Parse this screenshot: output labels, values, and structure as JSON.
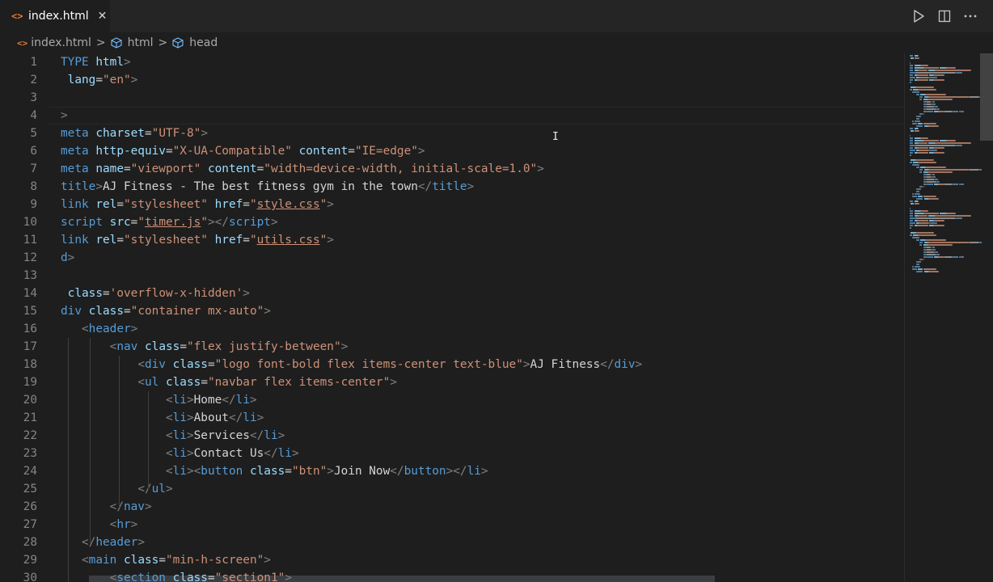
{
  "tab": {
    "icon": "html-file-icon",
    "icon_glyph": "<>",
    "label": "index.html",
    "close_glyph": "✕"
  },
  "actions": {
    "run": "run-icon",
    "split": "split-editor-icon",
    "more": "more-icon"
  },
  "breadcrumb": {
    "file": "index.html",
    "items": [
      "html",
      "head"
    ],
    "separator": ">"
  },
  "editor": {
    "lines": [
      {
        "n": "1",
        "tokens": [
          [
            "tag",
            "TYPE"
          ],
          [
            "text",
            " "
          ],
          [
            "attr",
            "html"
          ],
          [
            "brk",
            ">"
          ]
        ]
      },
      {
        "n": "2",
        "tokens": [
          [
            "text",
            " "
          ],
          [
            "attr",
            "lang"
          ],
          [
            "text",
            "="
          ],
          [
            "str",
            "\"en\""
          ],
          [
            "brk",
            ">"
          ]
        ]
      },
      {
        "n": "3",
        "tokens": []
      },
      {
        "n": "4",
        "tokens": [
          [
            "brk",
            ">"
          ]
        ]
      },
      {
        "n": "5",
        "tokens": [
          [
            "tag",
            "meta"
          ],
          [
            "text",
            " "
          ],
          [
            "attr",
            "charset"
          ],
          [
            "text",
            "="
          ],
          [
            "str",
            "\"UTF-8\""
          ],
          [
            "brk",
            ">"
          ]
        ]
      },
      {
        "n": "6",
        "tokens": [
          [
            "tag",
            "meta"
          ],
          [
            "text",
            " "
          ],
          [
            "attr",
            "http-equiv"
          ],
          [
            "text",
            "="
          ],
          [
            "str",
            "\"X-UA-Compatible\""
          ],
          [
            "text",
            " "
          ],
          [
            "attr",
            "content"
          ],
          [
            "text",
            "="
          ],
          [
            "str",
            "\"IE=edge\""
          ],
          [
            "brk",
            ">"
          ]
        ]
      },
      {
        "n": "7",
        "tokens": [
          [
            "tag",
            "meta"
          ],
          [
            "text",
            " "
          ],
          [
            "attr",
            "name"
          ],
          [
            "text",
            "="
          ],
          [
            "str",
            "\"viewport\""
          ],
          [
            "text",
            " "
          ],
          [
            "attr",
            "content"
          ],
          [
            "text",
            "="
          ],
          [
            "str",
            "\"width=device-width, initial-scale=1.0\""
          ],
          [
            "brk",
            ">"
          ]
        ]
      },
      {
        "n": "8",
        "tokens": [
          [
            "tag",
            "title"
          ],
          [
            "brk",
            ">"
          ],
          [
            "text",
            "AJ Fitness - The best fitness gym in the town"
          ],
          [
            "brk",
            "</"
          ],
          [
            "tag",
            "title"
          ],
          [
            "brk",
            ">"
          ]
        ]
      },
      {
        "n": "9",
        "tokens": [
          [
            "tag",
            "link"
          ],
          [
            "text",
            " "
          ],
          [
            "attr",
            "rel"
          ],
          [
            "text",
            "="
          ],
          [
            "str",
            "\"stylesheet\""
          ],
          [
            "text",
            " "
          ],
          [
            "attr",
            "href"
          ],
          [
            "text",
            "="
          ],
          [
            "str",
            "\""
          ],
          [
            "link",
            "style.css"
          ],
          [
            "str",
            "\""
          ],
          [
            "brk",
            ">"
          ]
        ]
      },
      {
        "n": "10",
        "tokens": [
          [
            "tag",
            "script"
          ],
          [
            "text",
            " "
          ],
          [
            "attr",
            "src"
          ],
          [
            "text",
            "="
          ],
          [
            "str",
            "\""
          ],
          [
            "link",
            "timer.js"
          ],
          [
            "str",
            "\""
          ],
          [
            "brk",
            "></"
          ],
          [
            "tag",
            "script"
          ],
          [
            "brk",
            ">"
          ]
        ]
      },
      {
        "n": "11",
        "tokens": [
          [
            "tag",
            "link"
          ],
          [
            "text",
            " "
          ],
          [
            "attr",
            "rel"
          ],
          [
            "text",
            "="
          ],
          [
            "str",
            "\"stylesheet\""
          ],
          [
            "text",
            " "
          ],
          [
            "attr",
            "href"
          ],
          [
            "text",
            "="
          ],
          [
            "str",
            "\""
          ],
          [
            "link",
            "utils.css"
          ],
          [
            "str",
            "\""
          ],
          [
            "brk",
            ">"
          ]
        ]
      },
      {
        "n": "12",
        "tokens": [
          [
            "tag",
            "d"
          ],
          [
            "brk",
            ">"
          ]
        ]
      },
      {
        "n": "13",
        "tokens": []
      },
      {
        "n": "14",
        "tokens": [
          [
            "text",
            " "
          ],
          [
            "attr",
            "class"
          ],
          [
            "text",
            "="
          ],
          [
            "str",
            "'overflow-x-hidden'"
          ],
          [
            "brk",
            ">"
          ]
        ]
      },
      {
        "n": "15",
        "tokens": [
          [
            "tag",
            "div"
          ],
          [
            "text",
            " "
          ],
          [
            "attr",
            "class"
          ],
          [
            "text",
            "="
          ],
          [
            "str",
            "\"container mx-auto\""
          ],
          [
            "brk",
            ">"
          ]
        ]
      },
      {
        "n": "16",
        "tokens": [
          [
            "text",
            "   "
          ],
          [
            "brk",
            "<"
          ],
          [
            "tag",
            "header"
          ],
          [
            "brk",
            ">"
          ]
        ]
      },
      {
        "n": "17",
        "tokens": [
          [
            "text",
            "       "
          ],
          [
            "brk",
            "<"
          ],
          [
            "tag",
            "nav"
          ],
          [
            "text",
            " "
          ],
          [
            "attr",
            "class"
          ],
          [
            "text",
            "="
          ],
          [
            "str",
            "\"flex justify-between\""
          ],
          [
            "brk",
            ">"
          ]
        ]
      },
      {
        "n": "18",
        "tokens": [
          [
            "text",
            "           "
          ],
          [
            "brk",
            "<"
          ],
          [
            "tag",
            "div"
          ],
          [
            "text",
            " "
          ],
          [
            "attr",
            "class"
          ],
          [
            "text",
            "="
          ],
          [
            "str",
            "\"logo font-bold flex items-center text-blue\""
          ],
          [
            "brk",
            ">"
          ],
          [
            "text",
            "AJ Fitness"
          ],
          [
            "brk",
            "</"
          ],
          [
            "tag",
            "div"
          ],
          [
            "brk",
            ">"
          ]
        ]
      },
      {
        "n": "19",
        "tokens": [
          [
            "text",
            "           "
          ],
          [
            "brk",
            "<"
          ],
          [
            "tag",
            "ul"
          ],
          [
            "text",
            " "
          ],
          [
            "attr",
            "class"
          ],
          [
            "text",
            "="
          ],
          [
            "str",
            "\"navbar flex items-center\""
          ],
          [
            "brk",
            ">"
          ]
        ]
      },
      {
        "n": "20",
        "tokens": [
          [
            "text",
            "               "
          ],
          [
            "brk",
            "<"
          ],
          [
            "tag",
            "li"
          ],
          [
            "brk",
            ">"
          ],
          [
            "text",
            "Home"
          ],
          [
            "brk",
            "</"
          ],
          [
            "tag",
            "li"
          ],
          [
            "brk",
            ">"
          ]
        ]
      },
      {
        "n": "21",
        "tokens": [
          [
            "text",
            "               "
          ],
          [
            "brk",
            "<"
          ],
          [
            "tag",
            "li"
          ],
          [
            "brk",
            ">"
          ],
          [
            "text",
            "About"
          ],
          [
            "brk",
            "</"
          ],
          [
            "tag",
            "li"
          ],
          [
            "brk",
            ">"
          ]
        ]
      },
      {
        "n": "22",
        "tokens": [
          [
            "text",
            "               "
          ],
          [
            "brk",
            "<"
          ],
          [
            "tag",
            "li"
          ],
          [
            "brk",
            ">"
          ],
          [
            "text",
            "Services"
          ],
          [
            "brk",
            "</"
          ],
          [
            "tag",
            "li"
          ],
          [
            "brk",
            ">"
          ]
        ]
      },
      {
        "n": "23",
        "tokens": [
          [
            "text",
            "               "
          ],
          [
            "brk",
            "<"
          ],
          [
            "tag",
            "li"
          ],
          [
            "brk",
            ">"
          ],
          [
            "text",
            "Contact Us"
          ],
          [
            "brk",
            "</"
          ],
          [
            "tag",
            "li"
          ],
          [
            "brk",
            ">"
          ]
        ]
      },
      {
        "n": "24",
        "tokens": [
          [
            "text",
            "               "
          ],
          [
            "brk",
            "<"
          ],
          [
            "tag",
            "li"
          ],
          [
            "brk",
            "><"
          ],
          [
            "tag",
            "button"
          ],
          [
            "text",
            " "
          ],
          [
            "attr",
            "class"
          ],
          [
            "text",
            "="
          ],
          [
            "str",
            "\"btn\""
          ],
          [
            "brk",
            ">"
          ],
          [
            "text",
            "Join Now"
          ],
          [
            "brk",
            "</"
          ],
          [
            "tag",
            "button"
          ],
          [
            "brk",
            "></"
          ],
          [
            "tag",
            "li"
          ],
          [
            "brk",
            ">"
          ]
        ]
      },
      {
        "n": "25",
        "tokens": [
          [
            "text",
            "           "
          ],
          [
            "brk",
            "</"
          ],
          [
            "tag",
            "ul"
          ],
          [
            "brk",
            ">"
          ]
        ]
      },
      {
        "n": "26",
        "tokens": [
          [
            "text",
            "       "
          ],
          [
            "brk",
            "</"
          ],
          [
            "tag",
            "nav"
          ],
          [
            "brk",
            ">"
          ]
        ]
      },
      {
        "n": "27",
        "tokens": [
          [
            "text",
            "       "
          ],
          [
            "brk",
            "<"
          ],
          [
            "tag",
            "hr"
          ],
          [
            "brk",
            ">"
          ]
        ]
      },
      {
        "n": "28",
        "tokens": [
          [
            "text",
            "   "
          ],
          [
            "brk",
            "</"
          ],
          [
            "tag",
            "header"
          ],
          [
            "brk",
            ">"
          ]
        ]
      },
      {
        "n": "29",
        "tokens": [
          [
            "text",
            "   "
          ],
          [
            "brk",
            "<"
          ],
          [
            "tag",
            "main"
          ],
          [
            "text",
            " "
          ],
          [
            "attr",
            "class"
          ],
          [
            "text",
            "="
          ],
          [
            "str",
            "\"min-h-screen\""
          ],
          [
            "brk",
            ">"
          ]
        ]
      },
      {
        "n": "30",
        "tokens": [
          [
            "text",
            "       "
          ],
          [
            "brk",
            "<"
          ],
          [
            "tag",
            "section"
          ],
          [
            "text",
            " "
          ],
          [
            "attr",
            "class"
          ],
          [
            "text",
            "="
          ],
          [
            "str",
            "\"section1\""
          ],
          [
            "brk",
            ">"
          ]
        ]
      }
    ]
  },
  "minimap": "minimap-preview",
  "colors": {
    "background": "#1e1e1e",
    "tag": "#569cd6",
    "attribute": "#9cdcfe",
    "string": "#ce9178",
    "bracket": "#808080",
    "text": "#d4d4d4",
    "line_number": "#858585",
    "file_icon": "#e37933"
  }
}
